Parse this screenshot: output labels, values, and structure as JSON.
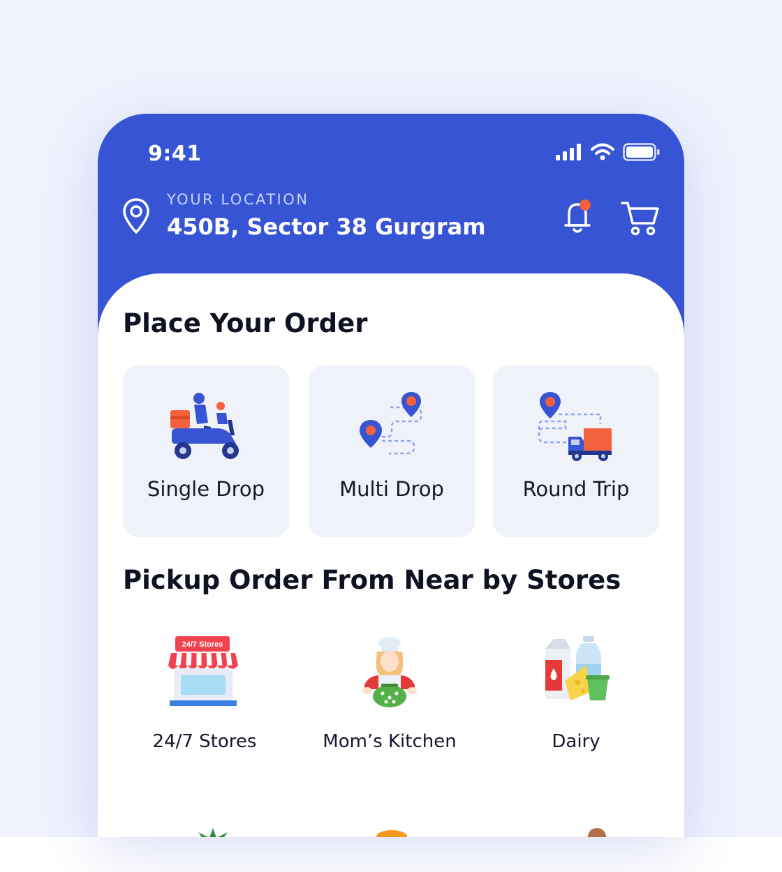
{
  "status_bar": {
    "time": "9:41",
    "icons": [
      "signal-icon",
      "wifi-icon",
      "battery-icon"
    ]
  },
  "header": {
    "location_caption": "YOUR LOCATION",
    "location_address": "450B, Sector 38 Gurgram",
    "icons": [
      "location-pin-icon",
      "bell-icon",
      "cart-icon"
    ]
  },
  "place_order": {
    "title": "Place Your Order",
    "options": [
      {
        "label": "Single Drop",
        "icon": "scooter-delivery-icon"
      },
      {
        "label": "Multi Drop",
        "icon": "multi-pin-route-icon"
      },
      {
        "label": "Round Trip",
        "icon": "truck-route-icon"
      }
    ]
  },
  "stores": {
    "title": "Pickup Order From Near by Stores",
    "items": [
      {
        "label": "24/7 Stores",
        "icon": "storefront-icon",
        "sign_text": "24/7 Stores"
      },
      {
        "label": "Mom’s Kitchen",
        "icon": "chef-icon"
      },
      {
        "label": "Dairy",
        "icon": "dairy-products-icon"
      }
    ]
  },
  "colors": {
    "primary": "#3654d3",
    "accent": "#f2623d",
    "card_bg": "#f0f2f9",
    "page_bg": "#eff2fd"
  }
}
